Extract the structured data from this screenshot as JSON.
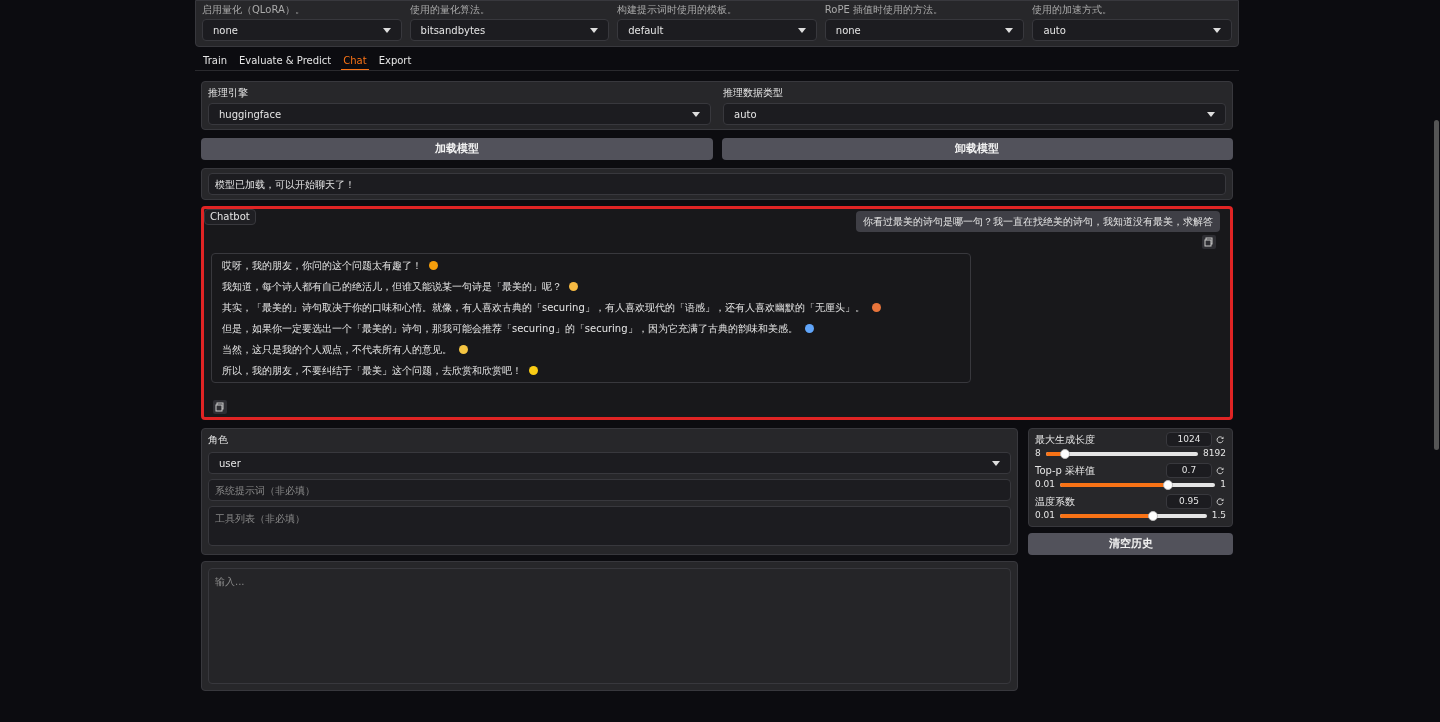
{
  "top_settings": [
    {
      "hint": "启用量化（QLoRA）。",
      "value": "none"
    },
    {
      "hint": "使用的量化算法。",
      "value": "bitsandbytes"
    },
    {
      "hint": "构建提示词时使用的模板。",
      "value": "default"
    },
    {
      "hint": "RoPE 插值时使用的方法。",
      "value": "none"
    },
    {
      "hint": "使用的加速方式。",
      "value": "auto"
    }
  ],
  "tabs": [
    {
      "label": "Train",
      "selected": false
    },
    {
      "label": "Evaluate & Predict",
      "selected": false
    },
    {
      "label": "Chat",
      "selected": true
    },
    {
      "label": "Export",
      "selected": false
    }
  ],
  "inference": [
    {
      "label": "推理引擎",
      "value": "huggingface"
    },
    {
      "label": "推理数据类型",
      "value": "auto"
    }
  ],
  "buttons": [
    "加载模型",
    "卸载模型"
  ],
  "status": "模型已加载，可以开始聊天了！",
  "chatbot": {
    "label": "Chatbot",
    "highlighted": true,
    "user_message": "你看过最美的诗句是哪一句？我一直在找绝美的诗句，我知道没有最美，求解答",
    "reply": [
      "哎呀，我的朋友，你问的这个问题太有趣了！",
      "我知道，每个诗人都有自己的绝活儿，但谁又能说某一句诗是「最美的」呢？",
      "其实，「最美的」诗句取决于你的口味和心情。就像，有人喜欢古典的「securing」，有人喜欢现代的「语感」，还有人喜欢幽默的「无厘头」。",
      "但是，如果你一定要选出一个「最美的」诗句，那我可能会推荐「securing」的「securing」，因为它充满了古典的韵味和美感。",
      "当然，这只是我的个人观点，不代表所有人的意见。",
      "所以，我的朋友，不要纠结于「最美」这个问题，去欣赏和欣赏吧！"
    ]
  },
  "role": {
    "label": "角色",
    "value": "user"
  },
  "system_prompt": {
    "placeholder": "系统提示词（非必填）"
  },
  "tools": {
    "placeholder": "工具列表（非必填）"
  },
  "sliders": [
    {
      "label": "最大生成长度",
      "value": "1024",
      "min": "8",
      "max": "8192",
      "level": 0.124
    },
    {
      "label": "Top-p 采样值",
      "value": "0.7",
      "min": "0.01",
      "max": "1",
      "level": 0.697
    },
    {
      "label": "温度系数",
      "value": "0.95",
      "min": "0.01",
      "max": "1.5",
      "level": 0.631
    }
  ],
  "clear_button": "清空历史",
  "input": {
    "placeholder": "输入..."
  }
}
